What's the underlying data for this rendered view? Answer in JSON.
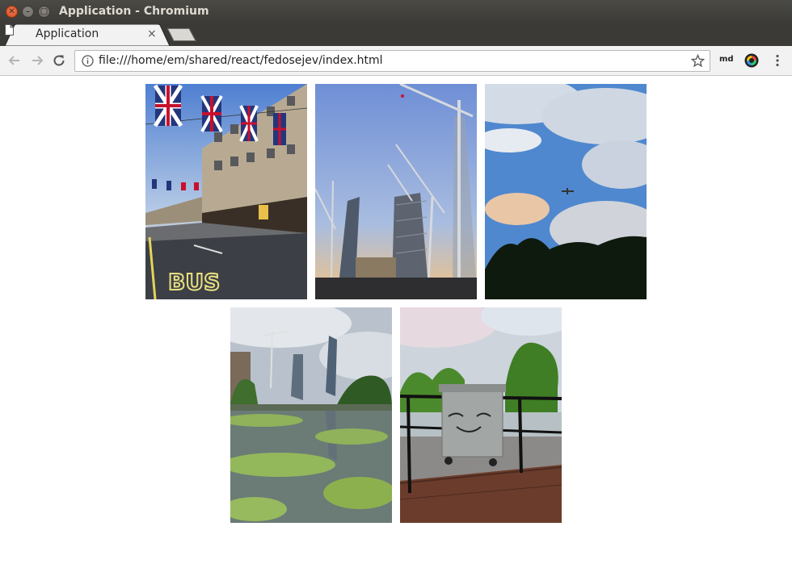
{
  "window": {
    "title": "Application - Chromium",
    "close_glyph": "✕",
    "minimize_glyph": "–",
    "maximize_glyph": "□"
  },
  "tab": {
    "title": "Application",
    "close_glyph": "×",
    "icon": "page-icon"
  },
  "toolbar": {
    "url": "file:///home/em/shared/react/fedosejev/index.html",
    "extension_label": "md",
    "icons": [
      "back-arrow-icon",
      "forward-arrow-icon",
      "reload-icon",
      "info-icon",
      "star-icon",
      "color-wheel-icon",
      "menu-dots-icon"
    ]
  },
  "gallery": {
    "photos": [
      {
        "subject": "London street with union jack flags and bus lane",
        "caption_mark": ""
      },
      {
        "subject": "Skyscraper construction with tower cranes",
        "caption_mark": ""
      },
      {
        "subject": "Cloudy sky with airplane over trees",
        "caption_mark": ""
      },
      {
        "subject": "Canal with duckweed and city towers",
        "caption_mark": ""
      },
      {
        "subject": "Wheelie bin with cat face by railing",
        "caption_mark": ""
      }
    ]
  },
  "colors": {
    "titlebar": "#3b3a36",
    "close_button": "#e05a2b",
    "toolbar": "#f2f2f2"
  }
}
